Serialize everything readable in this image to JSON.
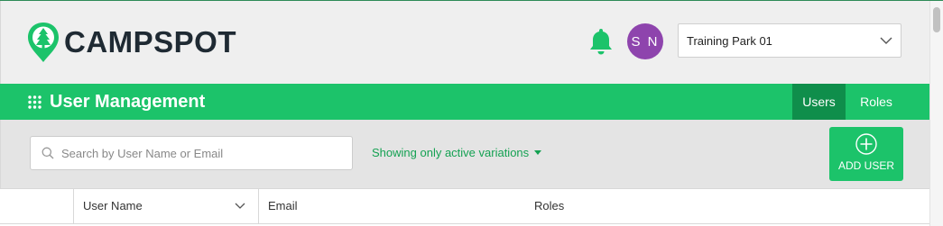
{
  "brand": {
    "name": "CAMPSPOT",
    "color": "#1cc36a"
  },
  "header": {
    "notification_icon": "bell-icon",
    "avatar_initials": "S N",
    "avatar_color": "#8e44ad",
    "park_select": {
      "value": "Training Park 01"
    }
  },
  "page": {
    "title": "User Management",
    "tabs": [
      {
        "label": "Users",
        "active": true
      },
      {
        "label": "Roles",
        "active": false
      }
    ]
  },
  "toolbar": {
    "search_placeholder": "Search by User Name or Email",
    "filter_label": "Showing only active variations",
    "add_user_label": "ADD USER"
  },
  "table": {
    "columns": [
      "",
      "User Name",
      "Email",
      "Roles"
    ]
  }
}
